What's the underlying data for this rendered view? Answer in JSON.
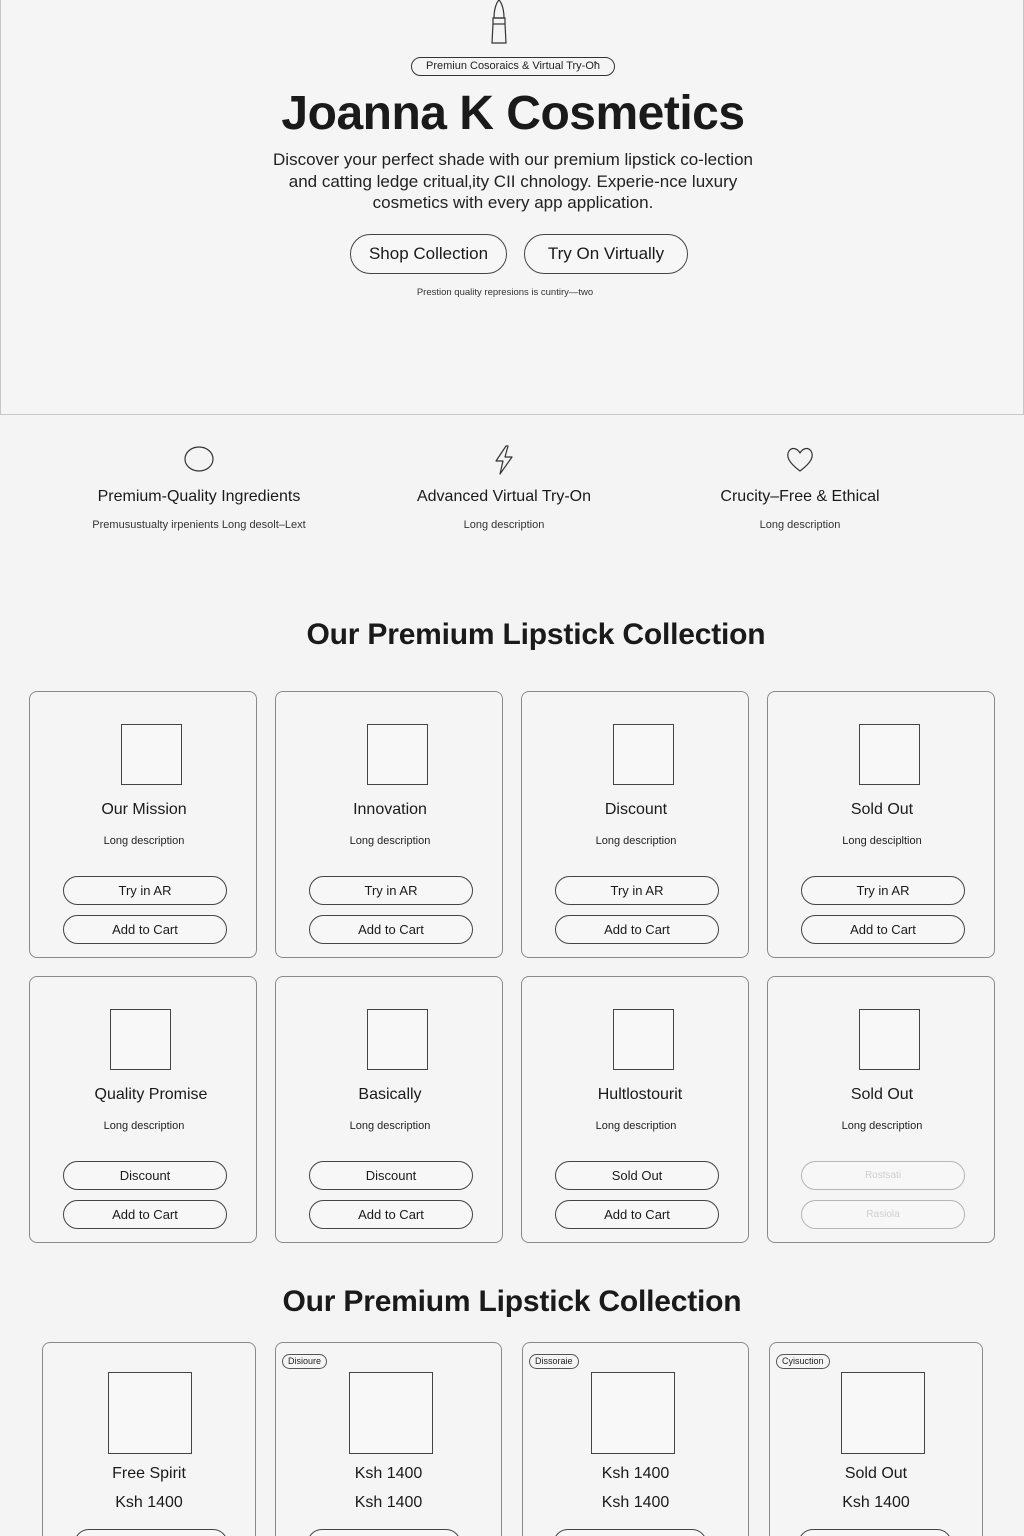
{
  "hero": {
    "badge": "Premiun Cosoraics & Virtual Try-Oħ",
    "title": "Joanna K Cosmetics",
    "description": "Discover your perfect shade with our premium lipstick co-lection and catting ledge critual‚ity CII chnology. Experie-nce luxury cosmetics with every app application.",
    "shop_button": "Shop Collection",
    "try_button": "Try On Virtually",
    "note": "Prestion quality represions is cuntiry—two"
  },
  "features": [
    {
      "icon": "circle-icon",
      "title": "Premium-Quality Ingredients",
      "description": "Premusustualty irpenients   Long desolt–Lext"
    },
    {
      "icon": "lightning-icon",
      "title": "Advanced Virtual Try-On",
      "description": "Long description"
    },
    {
      "icon": "heart-icon",
      "title": "Crucity–Free & Ethical",
      "description": "Long description"
    }
  ],
  "collection_title_1": "Our Premium Lipstick Collection",
  "products": [
    {
      "title": "Our Mission",
      "description": "Long description",
      "button1": "Try in AR",
      "button2": "Add to Cart"
    },
    {
      "title": "Innovation",
      "description": "Long description",
      "button1": "Try in AR",
      "button2": "Add to Cart"
    },
    {
      "title": "Discount",
      "description": "Long description",
      "button1": "Try in AR",
      "button2": "Add to Cart"
    },
    {
      "title": "Sold Out",
      "description": "Long descipltion",
      "button1": "Try in AR",
      "button2": "Add to Cart"
    },
    {
      "title": "Quality Promise",
      "description": "Long description",
      "button1": "Discount",
      "button2": "Add to Cart"
    },
    {
      "title": "Basically",
      "description": "Long description",
      "button1": "Discount",
      "button2": "Add to Cart"
    },
    {
      "title": "Hultlostourit",
      "description": "Long description",
      "button1": "Sold Out",
      "button2": "Add to Cart"
    },
    {
      "title": "Sold Out",
      "description": "Long description",
      "button1": "Rostsati",
      "button2": "Rasiola"
    }
  ],
  "collection_title_2": "Our Premium Lipstick Collection",
  "price_cards": [
    {
      "tag": "",
      "name": "Free Spirit",
      "price": "Ksh 1400"
    },
    {
      "tag": "Disioure",
      "name": "Ksh 1400",
      "price": "Ksh 1400"
    },
    {
      "tag": "Dissoraie",
      "name": "Ksh 1400",
      "price": "Ksh 1400"
    },
    {
      "tag": "Cyisuction",
      "name": "Sold Out",
      "price": "Ksh 1400"
    }
  ]
}
